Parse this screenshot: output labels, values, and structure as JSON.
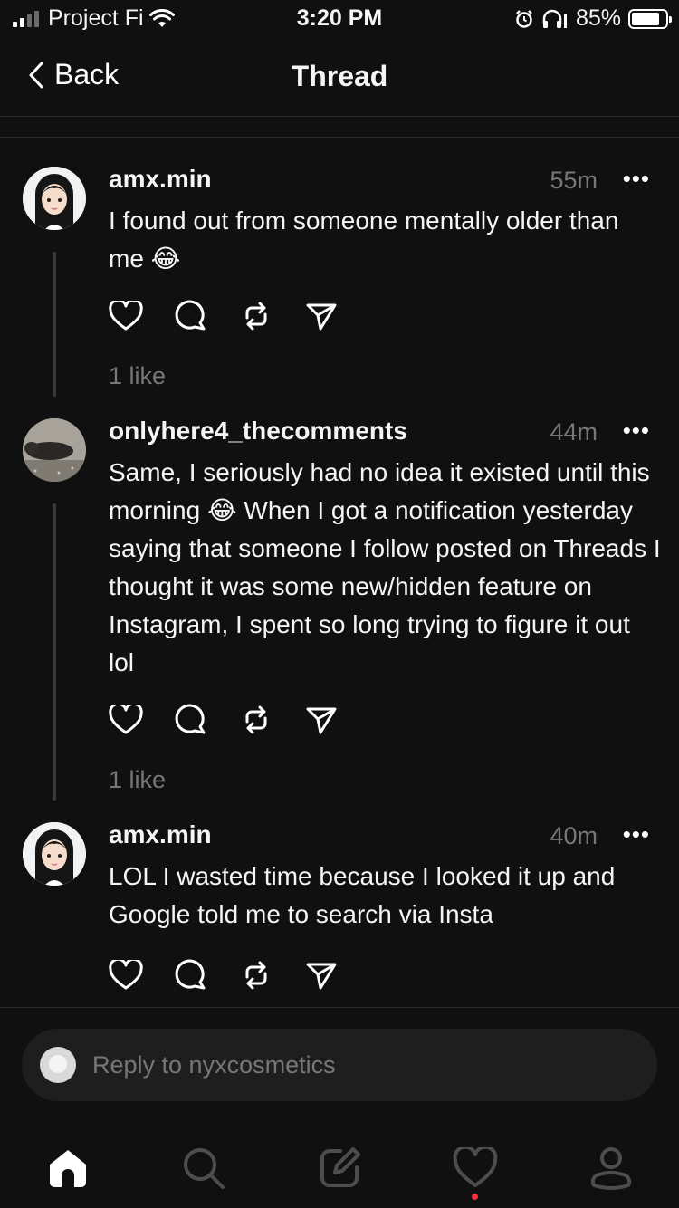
{
  "status_bar": {
    "carrier": "Project Fi",
    "time": "3:20 PM",
    "battery": "85%"
  },
  "nav": {
    "back_label": "Back",
    "title": "Thread"
  },
  "posts": [
    {
      "username": "amx.min",
      "time": "55m",
      "text": "I found out from someone mentally older than me 😂",
      "likes": "1 like"
    },
    {
      "username": "onlyhere4_thecomments",
      "time": "44m",
      "text": "Same, I seriously had no idea it existed until this morning 😂 When I got a notification yesterday saying that someone I follow posted on Threads I thought it was some new/hidden feature on Instagram, I spent so long trying to figure it out lol",
      "likes": "1 like"
    },
    {
      "username": "amx.min",
      "time": "40m",
      "text": "LOL I wasted time because I looked it up and Google told me to search via Insta",
      "likes": ""
    }
  ],
  "more_label": "•••",
  "reply": {
    "placeholder": "Reply to nyxcosmetics"
  },
  "tabs": [
    "home-icon",
    "search-icon",
    "compose-icon",
    "heart-icon",
    "profile-icon"
  ],
  "colors": {
    "background": "#101010",
    "text": "#f3f5f7",
    "secondary": "#777777",
    "notification": "#ff3040"
  }
}
